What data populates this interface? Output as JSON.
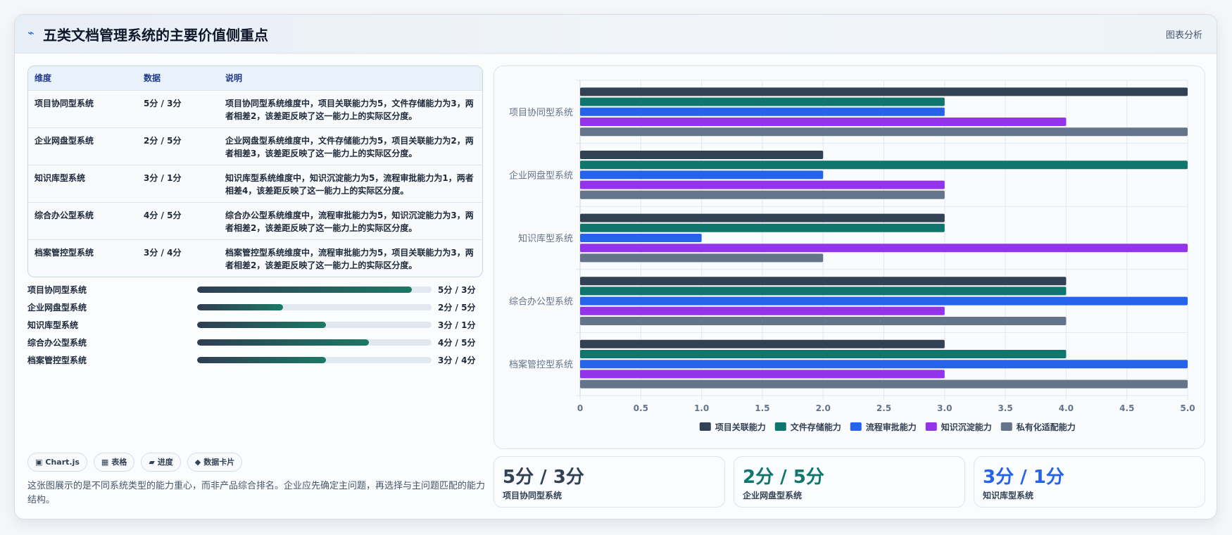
{
  "header": {
    "icon": "bolt-icon",
    "icon_glyph": "⌁",
    "title": "五类文档管理系统的主要价值侧重点",
    "link_label": "图表分析"
  },
  "table": {
    "columns": [
      "维度",
      "数据",
      "说明"
    ],
    "rows": [
      {
        "dim": "项目协同型系统",
        "data": "5分 / 3分",
        "desc": "项目协同型系统维度中，项目关联能力为5，文件存储能力为3，两者相差2，该差距反映了这一能力上的实际区分度。"
      },
      {
        "dim": "企业网盘型系统",
        "data": "2分 / 5分",
        "desc": "企业网盘型系统维度中，文件存储能力为5，项目关联能力为2，两者相差3，该差距反映了这一能力上的实际区分度。"
      },
      {
        "dim": "知识库型系统",
        "data": "3分 / 1分",
        "desc": "知识库型系统维度中，知识沉淀能力为5，流程审批能力为1，两者相差4，该差距反映了这一能力上的实际区分度。"
      },
      {
        "dim": "综合办公型系统",
        "data": "4分 / 5分",
        "desc": "综合办公型系统维度中，流程审批能力为5，知识沉淀能力为3，两者相差2，该差距反映了这一能力上的实际区分度。"
      },
      {
        "dim": "档案管控型系统",
        "data": "3分 / 4分",
        "desc": "档案管控型系统维度中，流程审批能力为5，项目关联能力为3，两者相差2，该差距反映了这一能力上的实际区分度。"
      }
    ]
  },
  "progress": [
    {
      "label": "项目协同型系统",
      "value": "5分 / 3分",
      "fraction": 0.917
    },
    {
      "label": "企业网盘型系统",
      "value": "2分 / 5分",
      "fraction": 0.367
    },
    {
      "label": "知识库型系统",
      "value": "3分 / 1分",
      "fraction": 0.55
    },
    {
      "label": "综合办公型系统",
      "value": "4分 / 5分",
      "fraction": 0.733
    },
    {
      "label": "档案管控型系统",
      "value": "3分 / 4分",
      "fraction": 0.55
    }
  ],
  "tags": [
    {
      "icon": "chart-icon",
      "glyph": "▣",
      "label": "Chart.js"
    },
    {
      "icon": "table-icon",
      "glyph": "▦",
      "label": "表格"
    },
    {
      "icon": "progress-icon",
      "glyph": "▰",
      "label": "进度"
    },
    {
      "icon": "diamond-icon",
      "glyph": "◆",
      "label": "数据卡片"
    }
  ],
  "note": "这张图展示的是不同系统类型的能力重心，而非产品综合排名。企业应先确定主问题，再选择与主问题匹配的能力结构。",
  "stats": [
    {
      "value": "5分 / 3分",
      "label": "项目协同型系统",
      "color": "#334155"
    },
    {
      "value": "2分 / 5分",
      "label": "企业网盘型系统",
      "color": "#0f766e"
    },
    {
      "value": "3分 / 1分",
      "label": "知识库型系统",
      "color": "#2563eb"
    }
  ],
  "chart_data": {
    "type": "bar",
    "orientation": "horizontal",
    "categories": [
      "项目协同型系统",
      "企业网盘型系统",
      "知识库型系统",
      "综合办公型系统",
      "档案管控型系统"
    ],
    "series": [
      {
        "name": "项目关联能力",
        "color": "#334155",
        "values": [
          5,
          2,
          3,
          4,
          3
        ]
      },
      {
        "name": "文件存储能力",
        "color": "#0f766e",
        "values": [
          3,
          5,
          3,
          4,
          4
        ]
      },
      {
        "name": "流程审批能力",
        "color": "#2563eb",
        "values": [
          3,
          2,
          1,
          5,
          5
        ]
      },
      {
        "name": "知识沉淀能力",
        "color": "#9333ea",
        "values": [
          4,
          3,
          5,
          3,
          3
        ]
      },
      {
        "name": "私有化适配能力",
        "color": "#64748b",
        "values": [
          5,
          3,
          2,
          4,
          5
        ]
      }
    ],
    "xlim": [
      0,
      5
    ],
    "xticks": [
      "0",
      "0.5",
      "1.0",
      "1.5",
      "2.0",
      "2.5",
      "3.0",
      "3.5",
      "4.0",
      "4.5",
      "5.0"
    ],
    "grid": true,
    "legend": "bottom"
  }
}
